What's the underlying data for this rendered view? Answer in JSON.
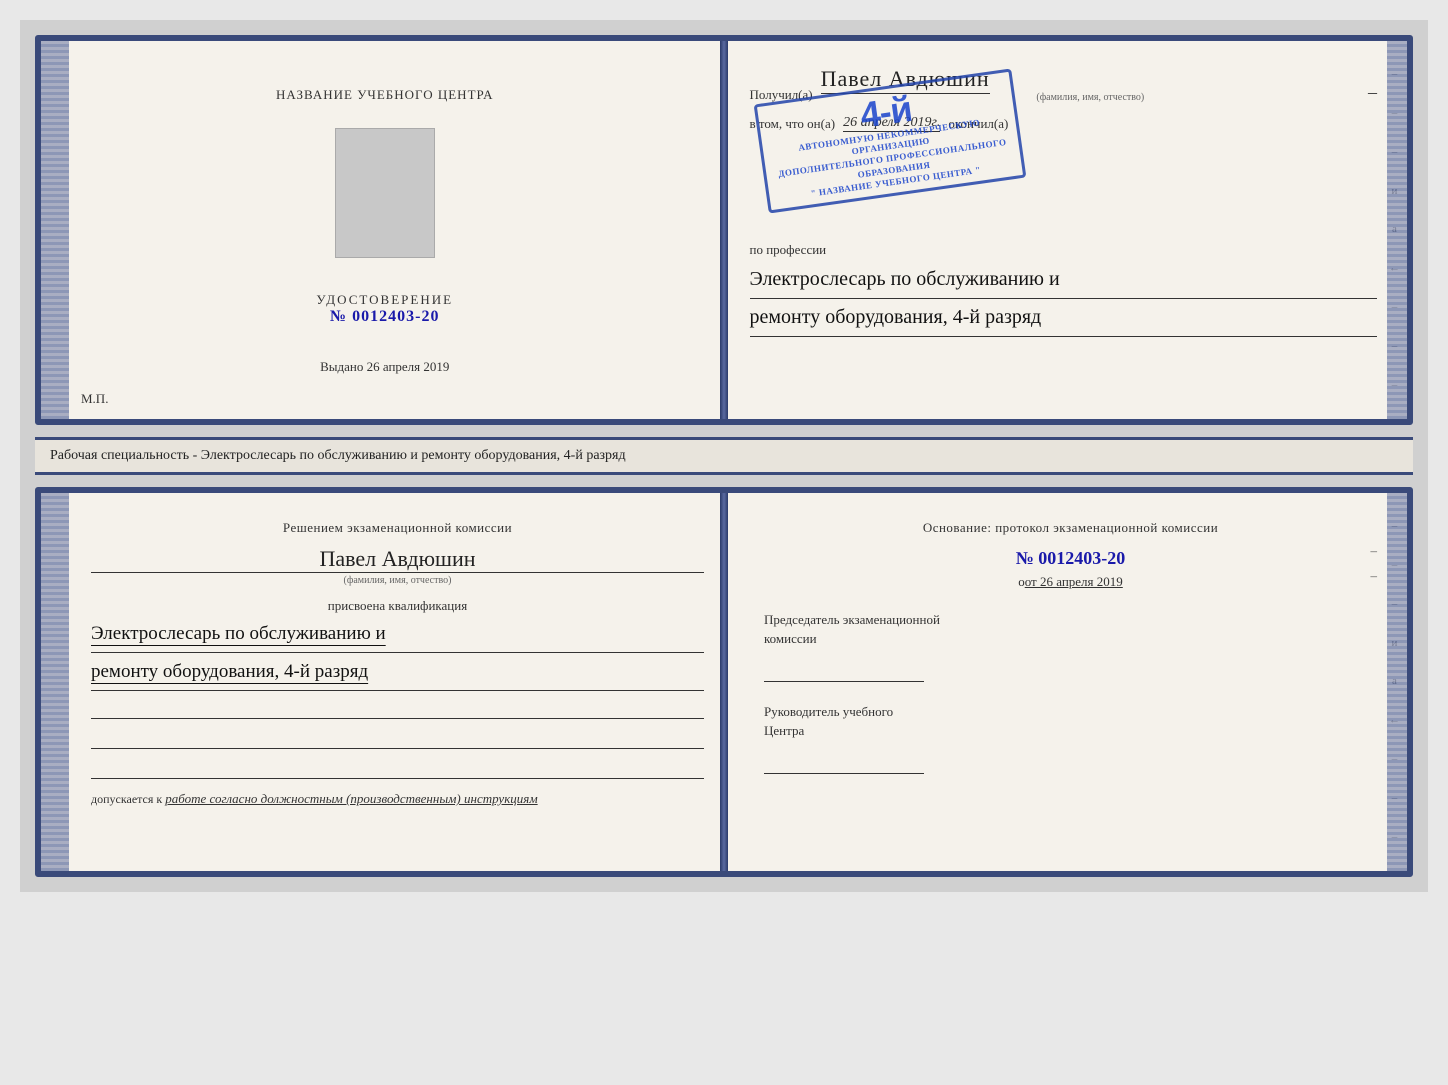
{
  "top_left": {
    "center_title": "НАЗВАНИЕ УЧЕБНОГО ЦЕНТРА",
    "udostoverenie_label": "УДОСТОВЕРЕНИЕ",
    "number": "№ 0012403-20",
    "vydano": "Выдано",
    "vydano_date": "26 апреля 2019",
    "mp": "М.П."
  },
  "top_right": {
    "poluchil": "Получил(a)",
    "name": "Павел Авдюшин",
    "fio_label": "(фамилия, имя, отчество)",
    "vtom": "в том, что он(а)",
    "date": "26 апреля 2019г.",
    "okonchil": "окончил(а)",
    "stamp_line1": "4-й",
    "stamp_line2": "АВТОНОМНУЮ НЕКОММЕРЧЕСКУЮ ОРГАНИЗАЦИЮ",
    "stamp_line3": "ДОПОЛНИТЕЛЬНОГО ПРОФЕССИОНАЛЬНОГО ОБРАЗОВАНИЯ",
    "stamp_line4": "\" НАЗВАНИЕ УЧЕБНОГО ЦЕНТРА \"",
    "po_professii": "по профессии",
    "profession_line1": "Электрослесарь по обслуживанию и",
    "profession_line2": "ремонту оборудования, 4-й разряд"
  },
  "specialty_text": "Рабочая специальность - Электрослесарь по обслуживанию и ремонту оборудования, 4-й разряд",
  "bottom_left": {
    "resheniem": "Решением экзаменационной комиссии",
    "name": "Павел Авдюшин",
    "fio_label": "(фамилия, имя, отчество)",
    "prisvoena": "присвоена квалификация",
    "qual_line1": "Электрослесарь по обслуживанию и",
    "qual_line2": "ремонту оборудования, 4-й разряд",
    "dopuskaetsya": "допускается к",
    "dopuskaetsya_italic": "работе согласно должностным (производственным) инструкциям"
  },
  "bottom_right": {
    "osnovanie": "Основание: протокол экзаменационной комиссии",
    "number": "№  0012403-20",
    "ot": "от 26 апреля 2019",
    "predsedatel_line1": "Председатель экзаменационной",
    "predsedatel_line2": "комиссии",
    "rukovoditel_line1": "Руководитель учебного",
    "rukovoditel_line2": "Центра"
  },
  "side_marks": [
    "–",
    "–",
    "–",
    "и",
    "а",
    "←",
    "–",
    "–",
    "–",
    "–"
  ],
  "side_marks2": [
    "–",
    "–",
    "–",
    "и",
    "а",
    "←",
    "–",
    "–",
    "–",
    "–"
  ]
}
